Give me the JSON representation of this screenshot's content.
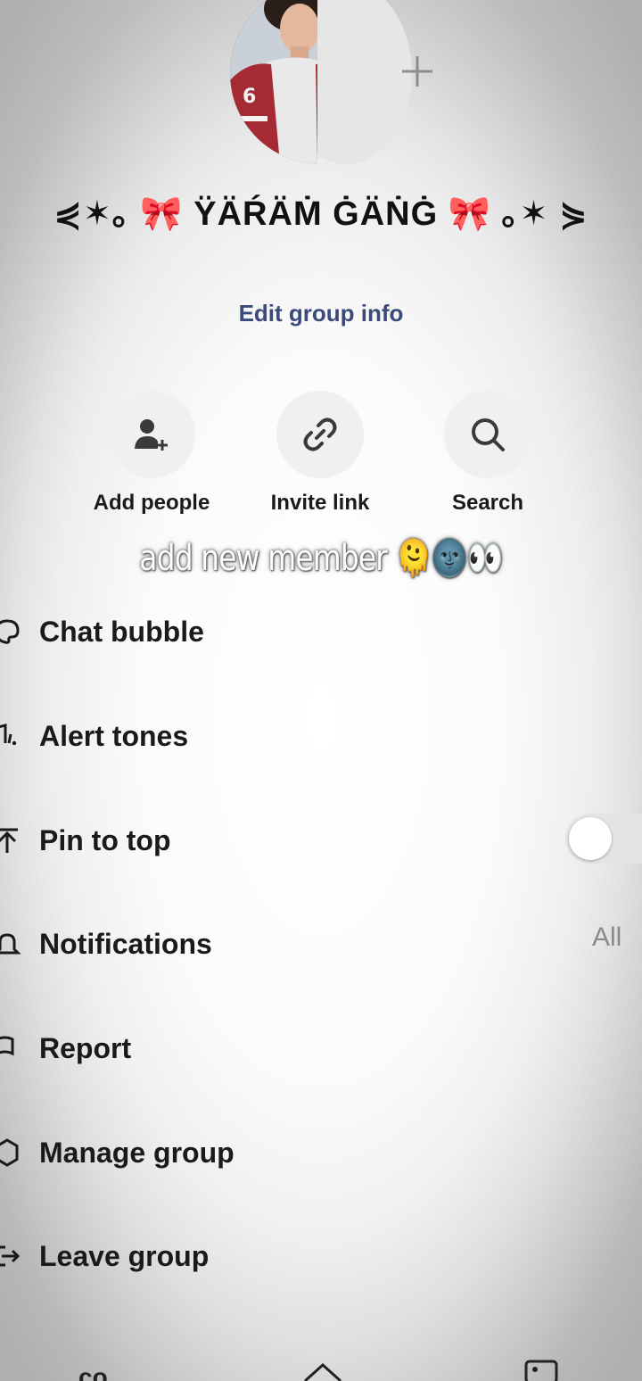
{
  "header": {
    "group_name": "⋞✶｡ 🎀 ŸÄŔÄṀ ĠÄṄĠ 🎀 ｡✶ ⋟",
    "edit_label": "Edit group info"
  },
  "actions": [
    {
      "label": "Add people",
      "icon": "add-person-icon"
    },
    {
      "label": "Invite link",
      "icon": "link-icon"
    },
    {
      "label": "Search",
      "icon": "search-icon"
    }
  ],
  "overlay": {
    "text": "add new member 🫠🌚👀"
  },
  "menu": [
    {
      "label": "Chat bubble",
      "icon": "palette-icon"
    },
    {
      "label": "Alert tones",
      "icon": "music-note-icon"
    },
    {
      "label": "Pin to top",
      "icon": "pin-top-icon"
    },
    {
      "label": "Notifications",
      "icon": "bell-icon"
    },
    {
      "label": "Report",
      "icon": "flag-icon"
    },
    {
      "label": "Manage group",
      "icon": "gear-icon"
    },
    {
      "label": "Leave group",
      "icon": "exit-icon"
    }
  ],
  "pin_to_top": {
    "enabled": false
  },
  "notifications": {
    "value": "All"
  },
  "bottom_nav": {
    "glyph": "co"
  },
  "colors": {
    "accent_link": "#3b4a7a",
    "background": "#f7f7f7"
  }
}
